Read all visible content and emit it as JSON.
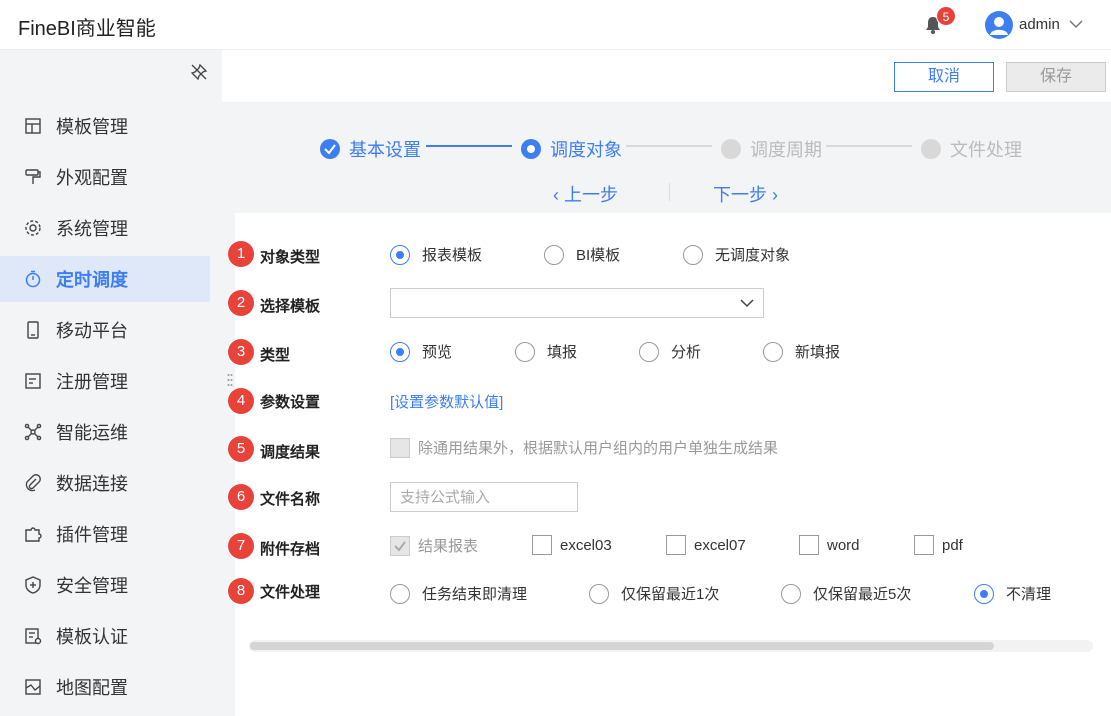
{
  "app": {
    "title": "FineBI商业智能"
  },
  "header": {
    "notification_count": "5",
    "username": "admin"
  },
  "sidebar": {
    "items": [
      {
        "label": "模板管理",
        "icon": "template-icon"
      },
      {
        "label": "外观配置",
        "icon": "paint-roller-icon"
      },
      {
        "label": "系统管理",
        "icon": "gear-icon"
      },
      {
        "label": "定时调度",
        "icon": "timer-icon",
        "active": true
      },
      {
        "label": "移动平台",
        "icon": "mobile-icon"
      },
      {
        "label": "注册管理",
        "icon": "register-icon"
      },
      {
        "label": "智能运维",
        "icon": "network-icon"
      },
      {
        "label": "数据连接",
        "icon": "paperclip-icon"
      },
      {
        "label": "插件管理",
        "icon": "puzzle-icon"
      },
      {
        "label": "安全管理",
        "icon": "shield-icon"
      },
      {
        "label": "模板认证",
        "icon": "certificate-icon"
      },
      {
        "label": "地图配置",
        "icon": "map-icon"
      }
    ]
  },
  "toolbar": {
    "cancel_label": "取消",
    "save_label": "保存"
  },
  "steps": [
    {
      "label": "基本设置",
      "state": "done"
    },
    {
      "label": "调度对象",
      "state": "current"
    },
    {
      "label": "调度周期",
      "state": "pending"
    },
    {
      "label": "文件处理",
      "state": "pending"
    }
  ],
  "step_nav": {
    "prev": "上一步",
    "next": "下一步"
  },
  "form": {
    "rows": [
      {
        "num": "1",
        "label": "对象类型"
      },
      {
        "num": "2",
        "label": "选择模板"
      },
      {
        "num": "3",
        "label": "类型"
      },
      {
        "num": "4",
        "label": "参数设置"
      },
      {
        "num": "5",
        "label": "调度结果"
      },
      {
        "num": "6",
        "label": "文件名称"
      },
      {
        "num": "7",
        "label": "附件存档"
      },
      {
        "num": "8",
        "label": "文件处理"
      }
    ],
    "object_type": {
      "options": [
        "报表模板",
        "BI模板",
        "无调度对象"
      ],
      "selected": 0
    },
    "select_template": {
      "value": ""
    },
    "type": {
      "options": [
        "预览",
        "填报",
        "分析",
        "新填报"
      ],
      "selected": 0
    },
    "param_link": "[设置参数默认值]",
    "schedule_result": {
      "label": "除通用结果外，根据默认用户组内的用户单独生成结果",
      "checked": false,
      "disabled": true
    },
    "file_name": {
      "value": "",
      "placeholder": "支持公式输入"
    },
    "attachment": {
      "options": [
        {
          "label": "结果报表",
          "checked": true,
          "disabled": true
        },
        {
          "label": "excel03",
          "checked": false
        },
        {
          "label": "excel07",
          "checked": false
        },
        {
          "label": "word",
          "checked": false
        },
        {
          "label": "pdf",
          "checked": false
        }
      ]
    },
    "file_process": {
      "options": [
        "任务结束即清理",
        "仅保留最近1次",
        "仅保留最近5次",
        "不清理"
      ],
      "selected": 3
    }
  },
  "colors": {
    "accent": "#3d7ef0",
    "badge": "#e8433a",
    "sidebar_bg": "#f3f4f6",
    "active_bg": "#dfe8f8"
  }
}
